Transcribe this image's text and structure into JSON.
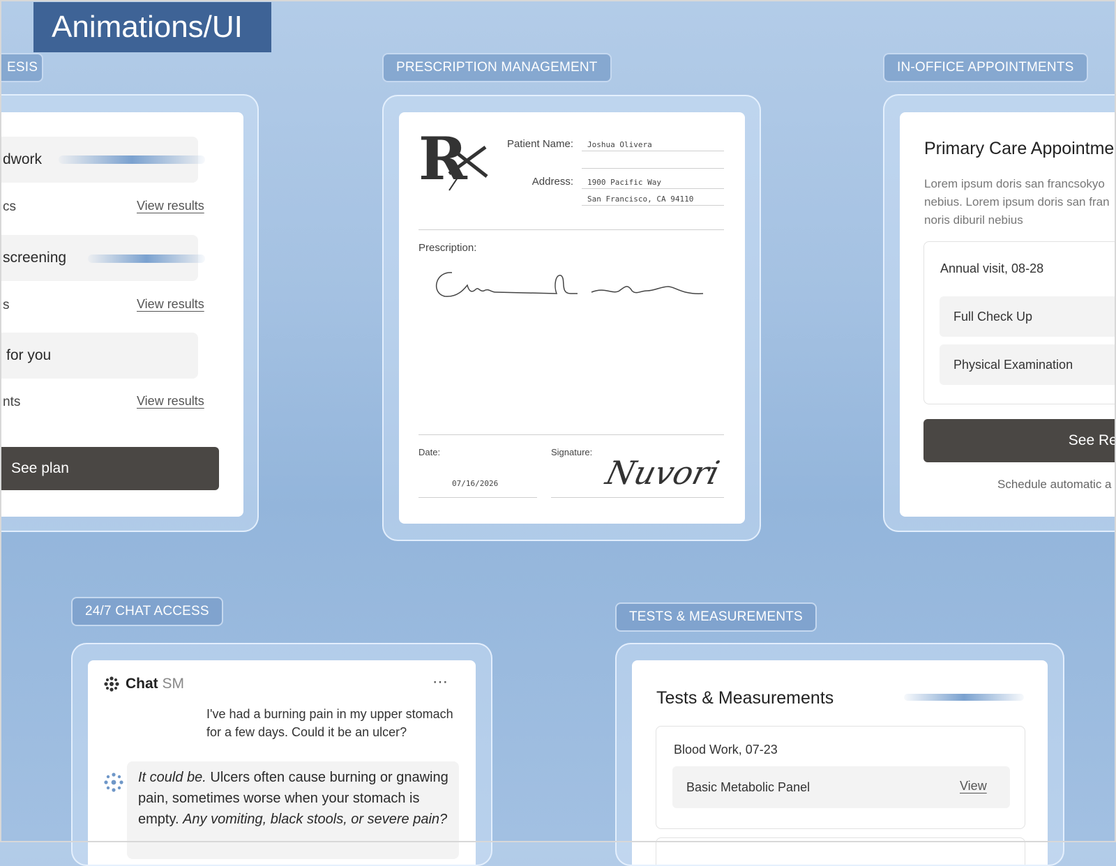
{
  "banner": {
    "title": "Animations/UI"
  },
  "labels": {
    "left": "ESIS",
    "prescription": "PRESCRIPTION MANAGEMENT",
    "appointments": "IN-OFFICE APPOINTMENTS",
    "chat": "24/7 CHAT ACCESS",
    "tests": "TESTS & MEASUREMENTS"
  },
  "left_card": {
    "rows": [
      {
        "title": "dwork",
        "sub": "cs",
        "link": "View results"
      },
      {
        "title": "screening",
        "sub": "s",
        "link": "View results"
      },
      {
        "title": "for you",
        "sub": "nts",
        "link": "View results"
      }
    ],
    "button": "See plan"
  },
  "prescription": {
    "patient_label": "Patient Name:",
    "patient_value": "Joshua Olivera",
    "address_label": "Address:",
    "address_line1": "1900 Pacific Way",
    "address_line2": "San Francisco, CA 94110",
    "prescription_label": "Prescription:",
    "date_label": "Date:",
    "date_value": "07/16/2026",
    "signature_label": "Signature:",
    "signature_text": "Nuvori"
  },
  "appointments": {
    "title": "Primary Care Appointme",
    "desc_lines": [
      "Lorem ipsum doris san francsokyo",
      "nebius. Lorem ipsum doris san fran",
      "noris diburil nebius"
    ],
    "visit": "Annual visit, 08-28",
    "items": [
      "Full Check Up",
      "Physical Examination"
    ],
    "button": "See Resu",
    "footer": "Schedule automatic a"
  },
  "chat": {
    "brand_bold": "Chat",
    "brand_light": "SM",
    "user_message_lines": [
      "I've had a burning pain in my upper stomach",
      "for a few days. Could it be an ulcer?"
    ],
    "reply_em": "It could be.",
    "reply_line1_rest": " Ulcers often cause burning or gnawing",
    "reply_line2": "pain, sometimes worse when your stomach is",
    "reply_line3_plain": "empty. ",
    "reply_line3_em": "Any vomiting, black stools, or severe pain?"
  },
  "tests": {
    "title": "Tests & Measurements",
    "group": "Blood Work, 07-23",
    "item": "Basic Metabolic Panel",
    "link": "View"
  },
  "colors": {
    "accent": "#3e6396",
    "dark_button": "#4a4744"
  }
}
